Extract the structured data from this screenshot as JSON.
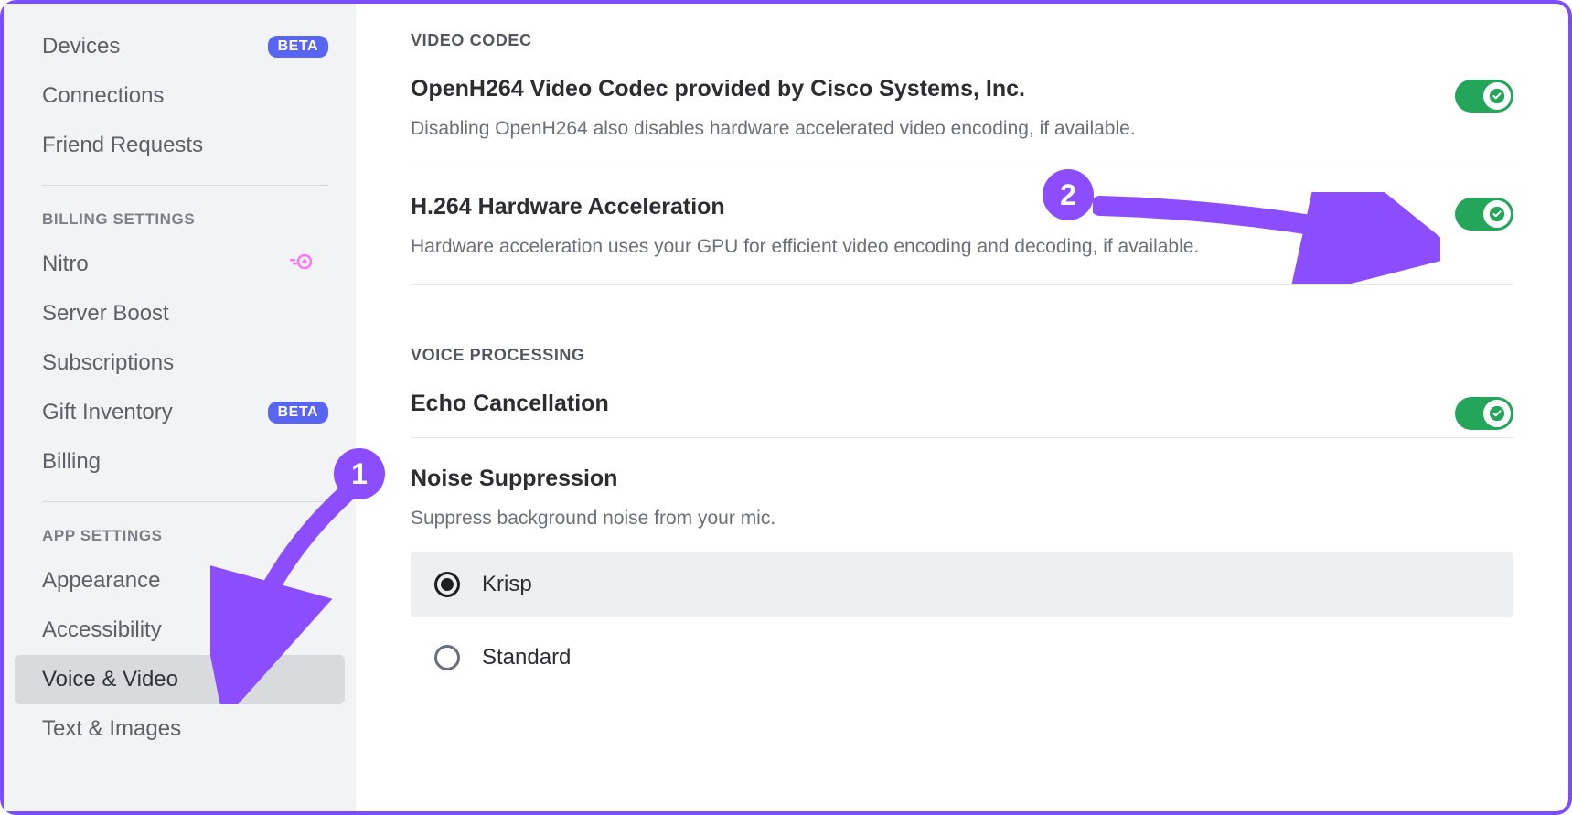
{
  "sidebar": {
    "items_top": [
      {
        "label": "Devices",
        "badge": "BETA"
      },
      {
        "label": "Connections",
        "badge": null
      },
      {
        "label": "Friend Requests",
        "badge": null
      }
    ],
    "billing_header": "BILLING SETTINGS",
    "items_billing": [
      {
        "label": "Nitro",
        "icon": "nitro"
      },
      {
        "label": "Server Boost"
      },
      {
        "label": "Subscriptions"
      },
      {
        "label": "Gift Inventory",
        "badge": "BETA"
      },
      {
        "label": "Billing"
      }
    ],
    "app_header": "APP SETTINGS",
    "items_app": [
      {
        "label": "Appearance",
        "selected": false
      },
      {
        "label": "Accessibility",
        "selected": false
      },
      {
        "label": "Voice & Video",
        "selected": true
      },
      {
        "label": "Text & Images",
        "selected": false
      }
    ]
  },
  "main": {
    "video_codec_header": "VIDEO CODEC",
    "openh264_title": "OpenH264 Video Codec provided by Cisco Systems, Inc.",
    "openh264_desc": "Disabling OpenH264 also disables hardware accelerated video encoding, if available.",
    "h264_title": "H.264 Hardware Acceleration",
    "h264_desc": "Hardware acceleration uses your GPU for efficient video encoding and decoding, if available.",
    "voice_proc_header": "VOICE PROCESSING",
    "echo_title": "Echo Cancellation",
    "noise_title": "Noise Suppression",
    "noise_desc": "Suppress background noise from your mic.",
    "radio_options": [
      "Krisp",
      "Standard"
    ],
    "toggles": {
      "openh264": true,
      "h264": true,
      "echo": true
    }
  },
  "annotations": {
    "badge1": "1",
    "badge2": "2"
  }
}
